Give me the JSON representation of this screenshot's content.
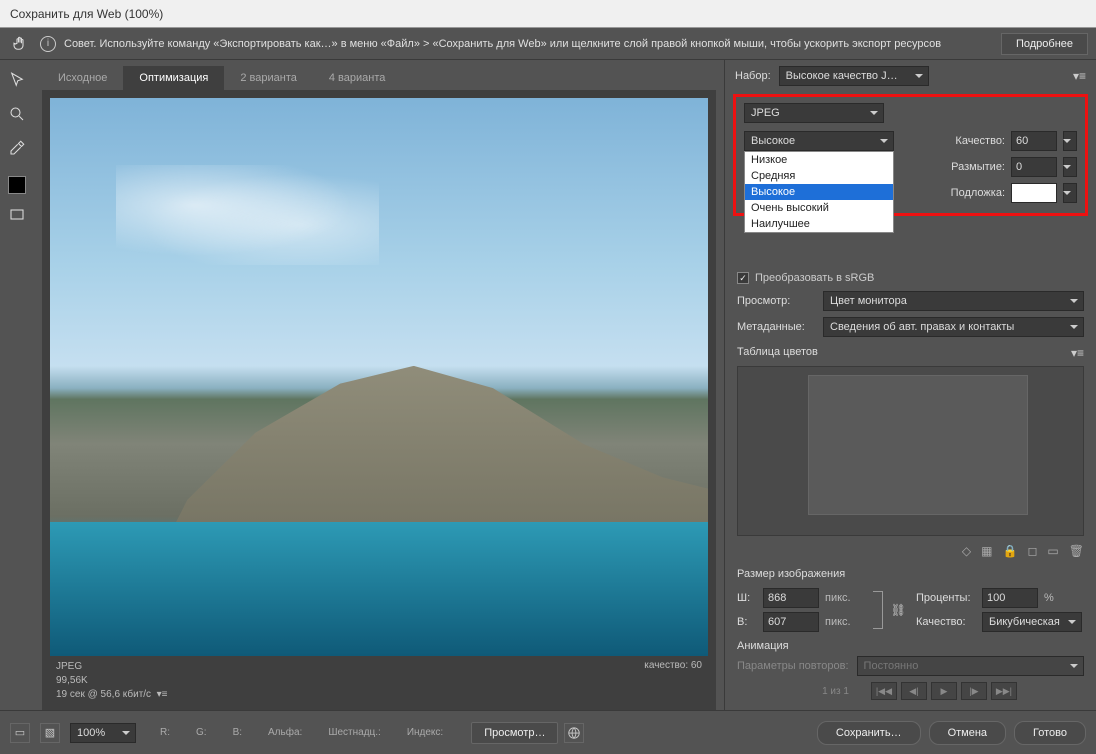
{
  "title": "Сохранить для Web (100%)",
  "tip": "Совет. Используйте команду «Экспортировать как…» в меню «Файл» > «Сохранить для Web» или щелкните слой правой кнопкой мыши, чтобы ускорить экспорт ресурсов",
  "more_btn": "Подробнее",
  "tabs": [
    "Исходное",
    "Оптимизация",
    "2 варианта",
    "4 варианта"
  ],
  "active_tab": 1,
  "meta": {
    "fmt": "JPEG",
    "size": "99,56K",
    "speed": "19 сек @ 56,6 кбит/с",
    "quality": "качество: 60"
  },
  "preset_label": "Набор:",
  "preset_value": "Высокое качество J…",
  "format_value": "JPEG",
  "quality_sel": "Высокое",
  "quality_options": [
    "Низкое",
    "Средняя",
    "Высокое",
    "Очень высокий",
    "Наилучшее"
  ],
  "quality_label": "Качество:",
  "quality_num": "60",
  "blur_label": "Размытие:",
  "blur_val": "0",
  "matte_label": "Подложка:",
  "srgb": "Преобразовать в sRGB",
  "preview_label": "Просмотр:",
  "preview_value": "Цвет монитора",
  "meta_label": "Метаданные:",
  "meta_value": "Сведения об авт. правах и контакты",
  "ct_label": "Таблица цветов",
  "imgsize_label": "Размер изображения",
  "w_label": "Ш:",
  "w_val": "868",
  "h_label": "В:",
  "h_val": "607",
  "px": "пикс.",
  "percent_label": "Проценты:",
  "percent_val": "100",
  "percent_unit": "%",
  "q_label": "Качество:",
  "q_val": "Бикубическая",
  "anim_label": "Анимация",
  "repeat_label": "Параметры повторов:",
  "repeat_val": "Постоянно",
  "pager": "1 из 1",
  "zoom": "100%",
  "readout": {
    "r": "R:",
    "g": "G:",
    "b": "B:",
    "a": "Альфа:",
    "hex": "Шестнадц.:",
    "idx": "Индекс:"
  },
  "preview_btn": "Просмотр…",
  "save_btn": "Сохранить…",
  "cancel_btn": "Отмена",
  "done_btn": "Готово"
}
